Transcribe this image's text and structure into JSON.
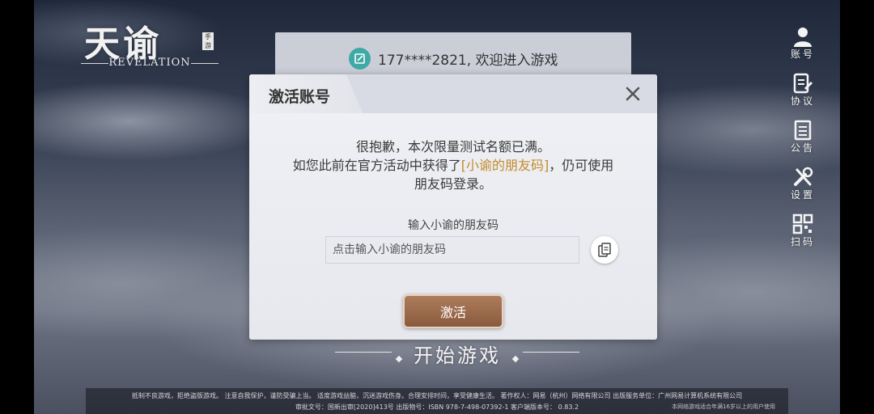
{
  "logo": {
    "title": "天谕",
    "seal": "手游",
    "subtitle": "REVELATION"
  },
  "right_menu": [
    {
      "label": "账号",
      "icon": "account-icon"
    },
    {
      "label": "协议",
      "icon": "agreement-icon"
    },
    {
      "label": "公告",
      "icon": "announcement-icon"
    },
    {
      "label": "设置",
      "icon": "settings-icon"
    },
    {
      "label": "扫码",
      "icon": "qr-code-icon"
    }
  ],
  "welcome": {
    "text": "177****2821, 欢迎进入游戏",
    "icon": "edit-icon"
  },
  "dialog": {
    "title": "激活账号",
    "message_line1": "很抱歉，本次限量测试名额已满。",
    "message_line2_pre": "如您此前在官方活动中获得了",
    "message_highlight": "[小谕的朋友码]",
    "message_line2_post": "，仍可使用",
    "message_line3": "朋友码登录。",
    "input_label": "输入小谕的朋友码",
    "input_placeholder": "点击输入小谕的朋友码",
    "input_value": "",
    "activate_label": "激活",
    "close_icon": "close-icon",
    "paste_icon": "paste-icon"
  },
  "start_game": {
    "label": "开始游戏"
  },
  "footer": {
    "line1": "抵制不良游戏，拒绝盗版游戏。 注意自我保护，谨防受骗上当。 适度游戏益脑，沉迷游戏伤身。合理安排时间，享受健康生活。 著作权人：网易（杭州）网络有限公司 出版服务单位：广州网易计算机系统有限公司",
    "line2": "审批文号：国新出审[2020]413号 出版物号：ISBN 978-7-498-07392-1 客户端版本号： 0.83.2",
    "age_notice": "本网络游戏适合年满16岁以上的用户使用"
  },
  "colors": {
    "accent_highlight": "#c28a2a",
    "activate_button": "#9b6a4c",
    "welcome_icon": "#3fa9a6"
  }
}
